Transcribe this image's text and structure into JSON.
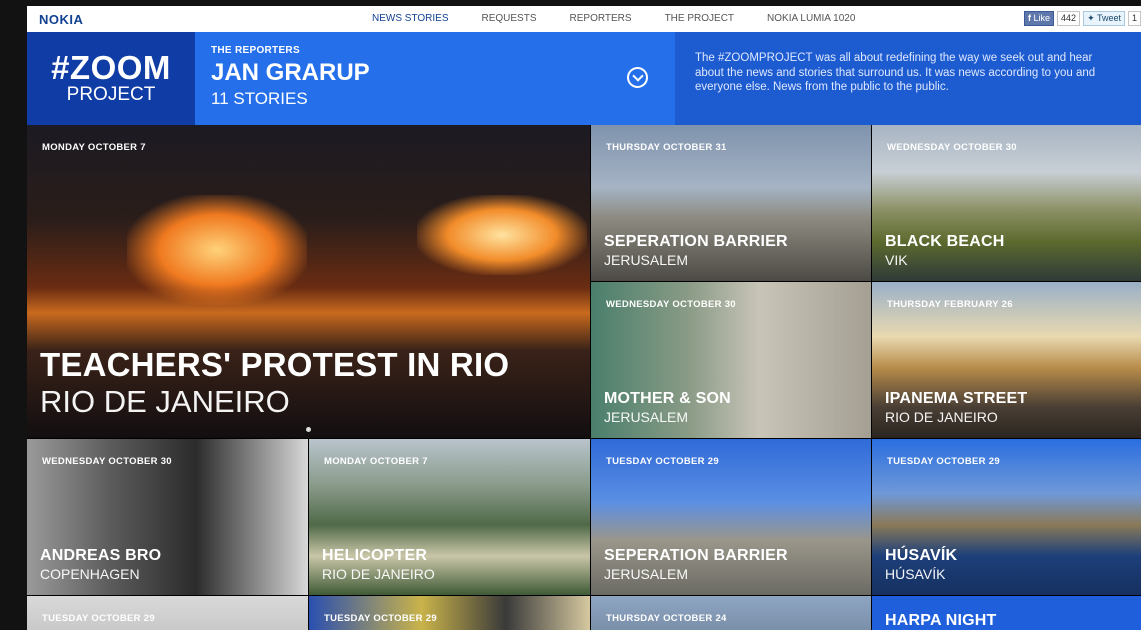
{
  "nav": {
    "logo": "NOKIA",
    "items": [
      {
        "label": "NEWS STORIES",
        "active": true
      },
      {
        "label": "REQUESTS",
        "active": false
      },
      {
        "label": "REPORTERS",
        "active": false
      },
      {
        "label": "THE PROJECT",
        "active": false
      },
      {
        "label": "NOKIA LUMIA 1020",
        "active": false
      }
    ],
    "social": {
      "like_label": "Like",
      "like_count": "442",
      "tweet_label": "Tweet",
      "tweet_count": "1"
    }
  },
  "header": {
    "brand_top": "#ZOOM",
    "brand_bottom": "PROJECT",
    "kicker": "THE REPORTERS",
    "reporter_name": "JAN GRARUP",
    "story_count": "11 STORIES",
    "about": "The #ZOOMPROJECT was all about redefining the way we seek out and hear about the news and stories that surround us. It was news according to you and everyone else. News from the public to the public."
  },
  "tiles": [
    {
      "date": "MONDAY OCTOBER 7",
      "title": "TEACHERS' PROTEST IN RIO",
      "place": "RIO DE JANEIRO"
    },
    {
      "date": "THURSDAY OCTOBER 31",
      "title": "SEPERATION BARRIER",
      "place": "JERUSALEM"
    },
    {
      "date": "WEDNESDAY OCTOBER 30",
      "title": "BLACK BEACH",
      "place": "VIK"
    },
    {
      "date": "WEDNESDAY OCTOBER 30",
      "title": "MOTHER & SON",
      "place": "JERUSALEM"
    },
    {
      "date": "THURSDAY FEBRUARY 26",
      "title": "IPANEMA STREET",
      "place": "RIO DE JANEIRO"
    },
    {
      "date": "WEDNESDAY OCTOBER 30",
      "title": "ANDREAS BRO",
      "place": "COPENHAGEN"
    },
    {
      "date": "MONDAY OCTOBER 7",
      "title": "HELICOPTER",
      "place": "RIO DE JANEIRO"
    },
    {
      "date": "TUESDAY OCTOBER 29",
      "title": "SEPERATION BARRIER",
      "place": "JERUSALEM"
    },
    {
      "date": "TUESDAY OCTOBER 29",
      "title": "HÚSAVÍK",
      "place": "HÚSAVÍK"
    },
    {
      "date": "TUESDAY OCTOBER 29"
    },
    {
      "date": "TUESDAY OCTOBER 29"
    },
    {
      "date": "THURSDAY OCTOBER 24"
    },
    {
      "title": "HARPA NIGHT"
    }
  ]
}
